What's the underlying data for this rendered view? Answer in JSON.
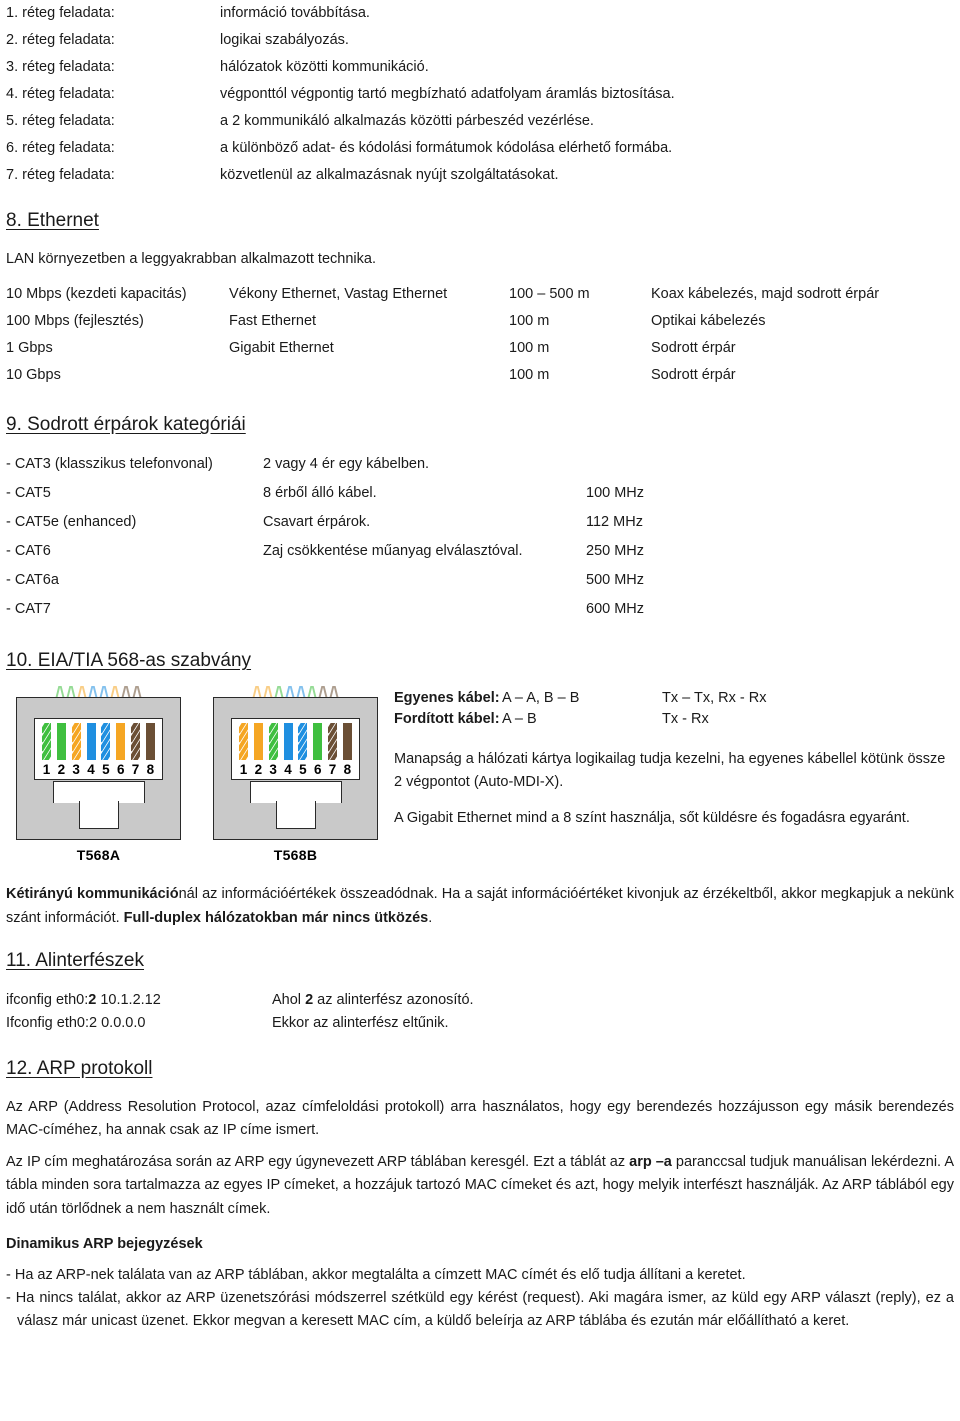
{
  "osi": {
    "rows": [
      {
        "label": "1. réteg feladata:",
        "desc": "információ továbbítása."
      },
      {
        "label": "2. réteg feladata:",
        "desc": "logikai szabályozás."
      },
      {
        "label": "3. réteg feladata:",
        "desc": "hálózatok közötti kommunikáció."
      },
      {
        "label": "4. réteg feladata:",
        "desc": "végponttól végpontig tartó megbízható adatfolyam áramlás biztosítása."
      },
      {
        "label": "5. réteg feladata:",
        "desc": "a 2 kommunikáló alkalmazás közötti párbeszéd vezérlése."
      },
      {
        "label": "6. réteg feladata:",
        "desc": "a különböző adat- és kódolási formátumok kódolása elérhető formába."
      },
      {
        "label": "7. réteg feladata:",
        "desc": "közvetlenül az alkalmazásnak nyújt szolgáltatásokat."
      }
    ]
  },
  "ethernet": {
    "heading": "8. Ethernet",
    "intro": "LAN környezetben a leggyakrabban alkalmazott technika.",
    "rows": [
      {
        "speed": "10 Mbps (kezdeti kapacitás)",
        "name": "Vékony Ethernet, Vastag Ethernet",
        "distance": "100 – 500 m",
        "media": "Koax kábelezés, majd sodrott érpár"
      },
      {
        "speed": "100 Mbps (fejlesztés)",
        "name": "Fast Ethernet",
        "distance": "100 m",
        "media": "Optikai kábelezés"
      },
      {
        "speed": "1 Gbps",
        "name": "Gigabit Ethernet",
        "distance": "100 m",
        "media": "Sodrott érpár"
      },
      {
        "speed": "10 Gbps",
        "name": "",
        "distance": "100 m",
        "media": "Sodrott érpár"
      }
    ]
  },
  "categories": {
    "heading": "9. Sodrott érpárok kategóriái",
    "rows": [
      {
        "cat": "- CAT3 (klasszikus telefonvonal)",
        "desc": "2 vagy 4 ér egy kábelben.",
        "freq": ""
      },
      {
        "cat": "- CAT5",
        "desc": "8 érből álló kábel.",
        "freq": "100 MHz"
      },
      {
        "cat": "- CAT5e (enhanced)",
        "desc": "Csavart érpárok.",
        "freq": "112 MHz"
      },
      {
        "cat": "- CAT6",
        "desc": "Zaj csökkentése műanyag elválasztóval.",
        "freq": "250 MHz"
      },
      {
        "cat": "- CAT6a",
        "desc": "",
        "freq": "500 MHz"
      },
      {
        "cat": "- CAT7",
        "desc": "",
        "freq": "600 MHz"
      }
    ]
  },
  "eiatia": {
    "heading": "10. EIA/TIA 568-as szabvány",
    "connectors": [
      {
        "caption": "T568A",
        "pins": [
          {
            "num": "1",
            "color": "#3fbf3f",
            "type": "striped"
          },
          {
            "num": "2",
            "color": "#3fbf3f",
            "type": "solid"
          },
          {
            "num": "3",
            "color": "#f5a623",
            "type": "striped"
          },
          {
            "num": "4",
            "color": "#1f8fe0",
            "type": "solid"
          },
          {
            "num": "5",
            "color": "#1f8fe0",
            "type": "striped"
          },
          {
            "num": "6",
            "color": "#f5a623",
            "type": "solid"
          },
          {
            "num": "7",
            "color": "#6b4f35",
            "type": "striped"
          },
          {
            "num": "8",
            "color": "#6b4f35",
            "type": "solid"
          }
        ]
      },
      {
        "caption": "T568B",
        "pins": [
          {
            "num": "1",
            "color": "#f5a623",
            "type": "striped"
          },
          {
            "num": "2",
            "color": "#f5a623",
            "type": "solid"
          },
          {
            "num": "3",
            "color": "#3fbf3f",
            "type": "striped"
          },
          {
            "num": "4",
            "color": "#1f8fe0",
            "type": "solid"
          },
          {
            "num": "5",
            "color": "#1f8fe0",
            "type": "striped"
          },
          {
            "num": "6",
            "color": "#3fbf3f",
            "type": "solid"
          },
          {
            "num": "7",
            "color": "#6b4f35",
            "type": "striped"
          },
          {
            "num": "8",
            "color": "#6b4f35",
            "type": "solid"
          }
        ]
      }
    ],
    "cable_rows": [
      {
        "label": "Egyenes kábel:",
        "pairing": "A – A, B – B",
        "signal": "Tx – Tx, Rx - Rx"
      },
      {
        "label": "Fordított kábel:",
        "pairing": "A – B",
        "signal": "Tx - Rx"
      }
    ],
    "para1": "Manapság a hálózati kártya logikailag tudja kezelni, ha egyenes kábellel kötünk össze 2 végpontot (Auto-MDI-X).",
    "para2": "A Gigabit Ethernet mind a 8 színt használja, sőt küldésre és fogadásra egyaránt."
  },
  "duplex": {
    "bold_lead": "Kétirányú kommunikáció",
    "text_mid": "nál az információértékek összeadódnak. Ha a saját információértéket kivonjuk az érzékeltből, akkor megkapjuk a nekünk szánt információt. ",
    "bold_end": "Full-duplex hálózatokban már nincs ütközés",
    "tail": "."
  },
  "subinterfaces": {
    "heading": "11. Alinterfészek",
    "rows": [
      {
        "cmd_pre": "ifconfig eth0:",
        "cmd_bold": "2",
        "cmd_post": " 10.1.2.12",
        "note_pre": "Ahol ",
        "note_bold": "2",
        "note_post": " az alinterfész azonosító."
      },
      {
        "cmd_pre": "Ifconfig eth0:2 0.0.0.0",
        "cmd_bold": "",
        "cmd_post": "",
        "note_pre": "Ekkor az alinterfész eltűnik.",
        "note_bold": "",
        "note_post": ""
      }
    ]
  },
  "arp": {
    "heading": "12. ARP protokoll",
    "para1": "Az ARP (Address Resolution Protocol, azaz címfeloldási protokoll) arra használatos, hogy egy berendezés hozzájusson egy másik berendezés MAC-címéhez, ha annak csak az IP címe ismert.",
    "para2_a": "Az IP cím meghatározása során az ARP egy úgynevezett ARP táblában keresgél. Ezt a táblát az ",
    "para2_bold": "arp –a",
    "para2_b": " paranccsal tudjuk manuálisan lekérdezni. A tábla minden sora tartalmazza az egyes IP címeket, a hozzájuk tartozó MAC címeket és azt, hogy melyik interfészt használják. Az ARP táblából egy idő után törlődnek a nem használt címek.",
    "dynamic_heading": "Dinamikus ARP bejegyzések",
    "bullets": [
      "- Ha az ARP-nek találata van az ARP táblában, akkor megtalálta a címzett MAC címét és elő tudja állítani a keretet.",
      "- Ha nincs találat, akkor az ARP üzenetszórási módszerrel szétküld egy kérést (request). Aki magára ismer, az küld egy ARP választ (reply), ez a válasz már unicast üzenet. Ekkor megvan a keresett MAC cím, a küldő beleírja az ARP táblába és ezután már előállítható a keret."
    ]
  }
}
